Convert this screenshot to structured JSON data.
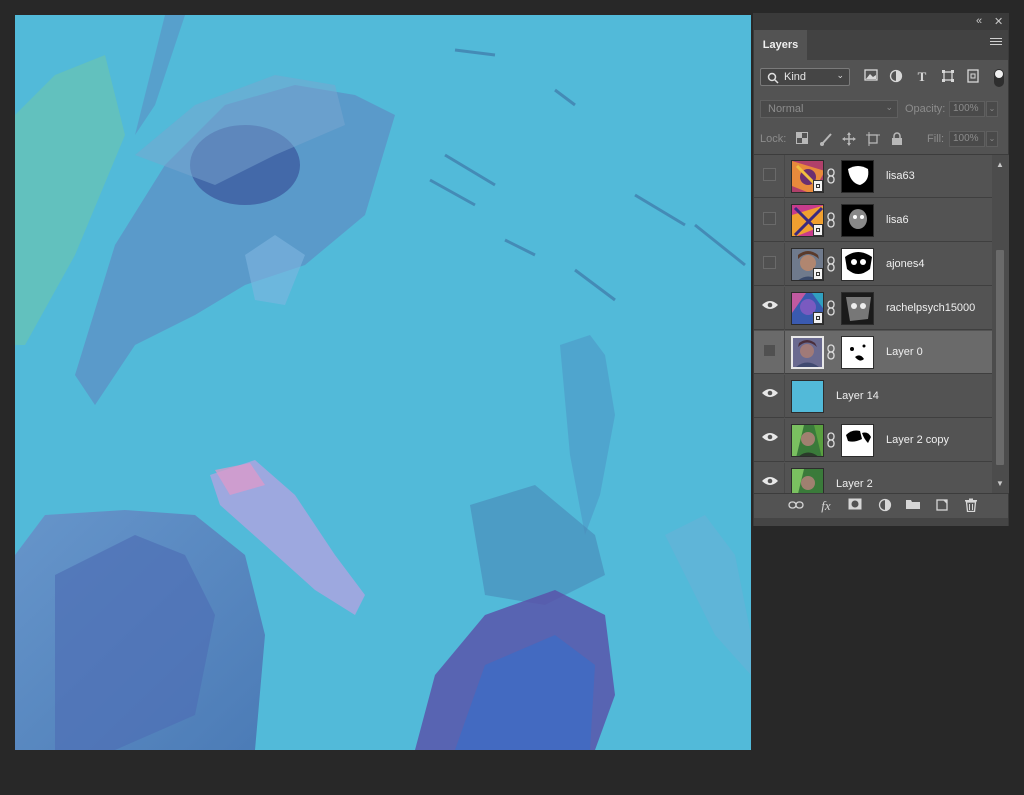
{
  "window_controls": {
    "collapse_glyph": "«",
    "close_glyph": "✕"
  },
  "panel": {
    "tab_label": "Layers",
    "menu_icon": "hamburger-icon"
  },
  "filter": {
    "kind_label": "Kind",
    "icons": [
      "image-filter-icon",
      "adjustment-filter-icon",
      "type-filter-icon",
      "shape-filter-icon",
      "smart-object-filter-icon"
    ],
    "toggle_state": "on"
  },
  "blend": {
    "mode": "Normal",
    "opacity_label": "Opacity:",
    "opacity_value": "100%"
  },
  "lock": {
    "label": "Lock:",
    "fill_label": "Fill:",
    "fill_value": "100%",
    "icons": [
      "lock-transparent-icon",
      "lock-paint-icon",
      "lock-position-icon",
      "lock-artboard-icon",
      "lock-all-icon"
    ]
  },
  "layers": [
    {
      "name": "lisa63",
      "visible": false,
      "selected": false,
      "has_mask": true,
      "smart_object": true
    },
    {
      "name": "lisa6",
      "visible": false,
      "selected": false,
      "has_mask": true,
      "smart_object": true
    },
    {
      "name": "ajones4",
      "visible": false,
      "selected": false,
      "has_mask": true,
      "smart_object": true
    },
    {
      "name": "rachelpsych15000",
      "visible": true,
      "selected": false,
      "has_mask": true,
      "smart_object": true
    },
    {
      "name": "Layer 0",
      "visible": false,
      "selected": true,
      "has_mask": true,
      "smart_object": false
    },
    {
      "name": "Layer 14",
      "visible": true,
      "selected": false,
      "has_mask": false,
      "smart_object": false
    },
    {
      "name": "Layer 2 copy",
      "visible": true,
      "selected": false,
      "has_mask": true,
      "smart_object": false
    },
    {
      "name": "Layer 2",
      "visible": true,
      "selected": false,
      "has_mask": false,
      "smart_object": false
    }
  ],
  "footer_icons": [
    "link-layers-icon",
    "fx-icon",
    "add-mask-icon",
    "adjustment-layer-icon",
    "new-group-icon",
    "new-layer-icon",
    "delete-layer-icon"
  ],
  "colors": {
    "canvas": "#52bad9",
    "workspace": "#282828",
    "panel": "#535353",
    "selected_row": "#6a6a6a"
  }
}
